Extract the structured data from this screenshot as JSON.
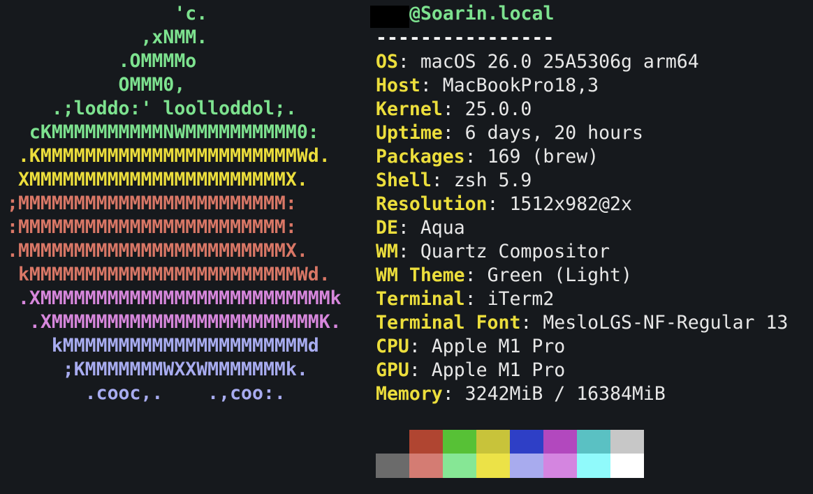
{
  "logo": [
    {
      "text": "               'c.",
      "color": "#7de28f"
    },
    {
      "text": "            ,xNMM.",
      "color": "#7de28f"
    },
    {
      "text": "          .OMMMMo",
      "color": "#7de28f"
    },
    {
      "text": "          OMMM0,",
      "color": "#7de28f"
    },
    {
      "text": "    .;loddo:' loolloddol;.",
      "color": "#7de28f"
    },
    {
      "text": "  cKMMMMMMMMMMNWMMMMMMMMMM0:",
      "color": "#7de28f"
    },
    {
      "text": " .KMMMMMMMMMMMMMMMMMMMMMMMWd.",
      "color": "#ecde3c"
    },
    {
      "text": " XMMMMMMMMMMMMMMMMMMMMMMMX.",
      "color": "#ecde3c"
    },
    {
      "text": ";MMMMMMMMMMMMMMMMMMMMMMMM:",
      "color": "#d97766"
    },
    {
      "text": ":MMMMMMMMMMMMMMMMMMMMMMMM:",
      "color": "#d97766"
    },
    {
      "text": ".MMMMMMMMMMMMMMMMMMMMMMMMX.",
      "color": "#d97766"
    },
    {
      "text": " kMMMMMMMMMMMMMMMMMMMMMMMMWd.",
      "color": "#d97766"
    },
    {
      "text": " .XMMMMMMMMMMMMMMMMMMMMMMMMMMk",
      "color": "#d787dc"
    },
    {
      "text": "  .XMMMMMMMMMMMMMMMMMMMMMMMMK.",
      "color": "#d787dc"
    },
    {
      "text": "    kMMMMMMMMMMMMMMMMMMMMMMd",
      "color": "#a8acf0"
    },
    {
      "text": "     ;KMMMMMMMWXXWMMMMMMMk.",
      "color": "#a8acf0"
    },
    {
      "text": "       .cooc,.    .,coo:.",
      "color": "#a8acf0"
    }
  ],
  "title": {
    "host": "@Soarin.local",
    "separator": "----------------"
  },
  "info": [
    {
      "key": "OS",
      "value": "macOS 26.0 25A5306g arm64"
    },
    {
      "key": "Host",
      "value": "MacBookPro18,3"
    },
    {
      "key": "Kernel",
      "value": "25.0.0"
    },
    {
      "key": "Uptime",
      "value": "6 days, 20 hours"
    },
    {
      "key": "Packages",
      "value": "169 (brew)"
    },
    {
      "key": "Shell",
      "value": "zsh 5.9"
    },
    {
      "key": "Resolution",
      "value": "1512x982@2x"
    },
    {
      "key": "DE",
      "value": "Aqua"
    },
    {
      "key": "WM",
      "value": "Quartz Compositor"
    },
    {
      "key": "WM Theme",
      "value": "Green (Light)"
    },
    {
      "key": "Terminal",
      "value": "iTerm2"
    },
    {
      "key": "Terminal Font",
      "value": "MesloLGS-NF-Regular 13"
    },
    {
      "key": "CPU",
      "value": "Apple M1 Pro"
    },
    {
      "key": "GPU",
      "value": "Apple M1 Pro"
    },
    {
      "key": "Memory",
      "value": "3242MiB / 16384MiB"
    }
  ],
  "colors": {
    "background": "#16191d",
    "key": "#ecde3c",
    "host_green": "#7de28f",
    "value_text": "#e8e8e8",
    "palette_normal": [
      "#16191d",
      "#b04531",
      "#57c136",
      "#c8c33a",
      "#2e3fc6",
      "#b248be",
      "#5ac1c3",
      "#c7c7c7"
    ],
    "palette_bright": [
      "#6b6b6b",
      "#d47c73",
      "#86e795",
      "#ece247",
      "#a8abee",
      "#d485e0",
      "#90fafb",
      "#ffffff"
    ]
  }
}
